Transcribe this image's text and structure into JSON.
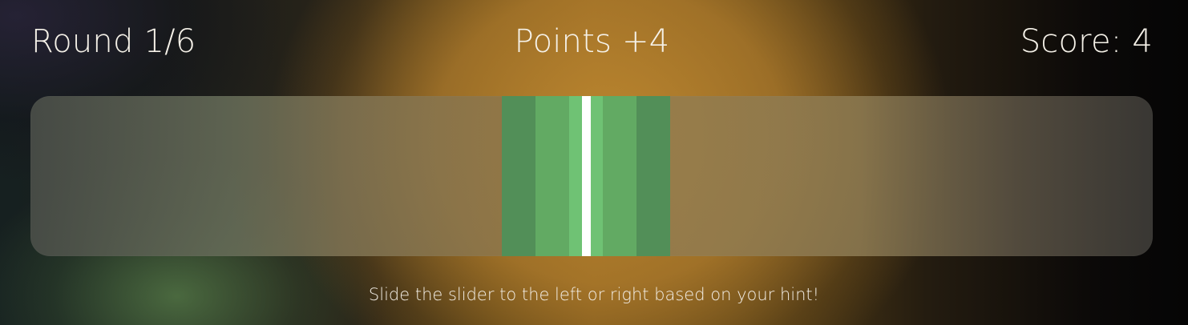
{
  "hud": {
    "round": "Round 1/6",
    "points": "Points +4",
    "score": "Score: 4"
  },
  "slider": {
    "target_zone": {
      "colors": {
        "outer": "#528f58",
        "mid": "#62aa63",
        "inner": "#6fc274",
        "center": "#ffffff"
      }
    }
  },
  "hint": {
    "text": "Slide the slider to the left or right based on your hint!"
  }
}
